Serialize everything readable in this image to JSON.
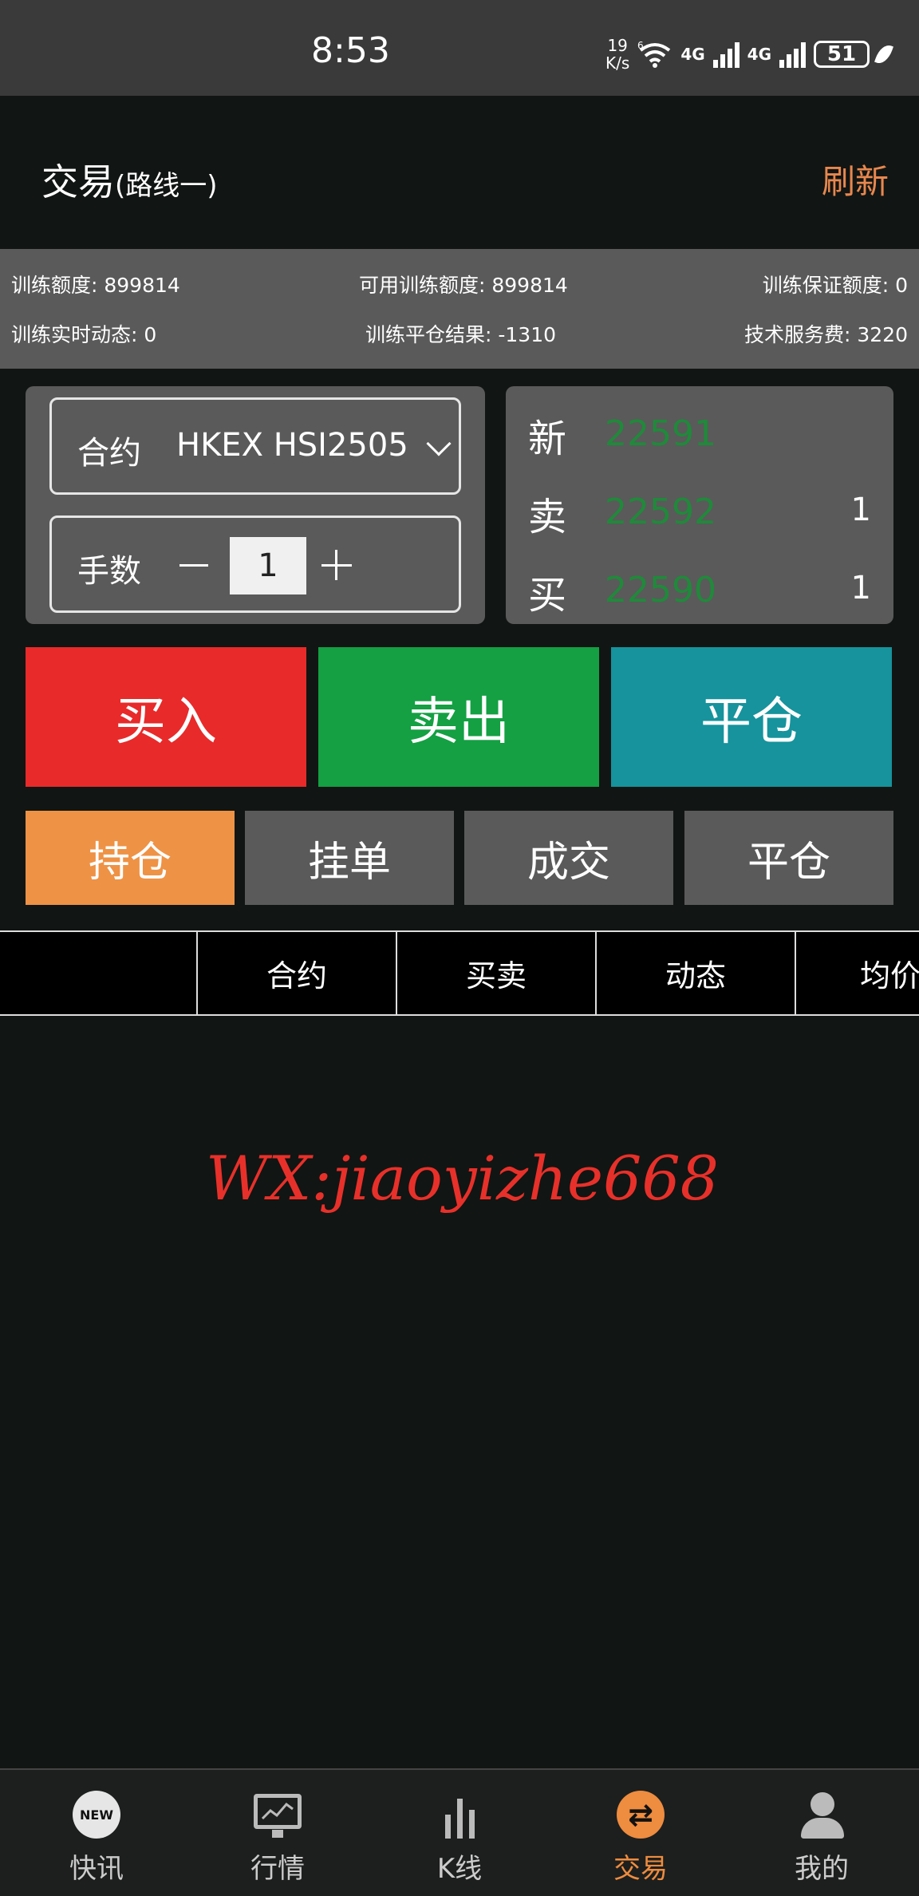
{
  "status_bar": {
    "time": "8:53",
    "net_speed_value": "19",
    "net_speed_unit": "K/s",
    "sig1_label": "4G",
    "sig2_label": "4G",
    "wifi_badge": "6",
    "battery": "51",
    "icons": [
      "wifi-icon",
      "signal-icon",
      "signal-icon",
      "battery-icon",
      "leaf-icon"
    ]
  },
  "header": {
    "title": "交易",
    "subtitle": "(路线一)",
    "refresh": "刷新",
    "accent": "#e8874e"
  },
  "info": {
    "quota": "训练额度: 899814",
    "available": "可用训练额度: 899814",
    "margin": "训练保证额度: 0",
    "realtime": "训练实时动态: 0",
    "close_result": "训练平仓结果: -1310",
    "service_fee": "技术服务费: 3220"
  },
  "contract": {
    "label": "合约",
    "value": "HKEX HSI2505",
    "lots_label": "手数",
    "lots_value": "1"
  },
  "quote": {
    "latest_label": "新",
    "latest": "22591",
    "ask_label": "卖",
    "ask": "22592",
    "ask_qty": "1",
    "bid_label": "买",
    "bid": "22590",
    "bid_qty": "1",
    "price_color": "#1f8a3a"
  },
  "actions": {
    "buy": "买入",
    "sell": "卖出",
    "close": "平仓",
    "colors": {
      "buy": "#e82a2a",
      "sell": "#14a043",
      "close": "#16939c"
    }
  },
  "tabs": [
    {
      "label": "持仓",
      "active": true
    },
    {
      "label": "挂单",
      "active": false
    },
    {
      "label": "成交",
      "active": false
    },
    {
      "label": "平仓",
      "active": false
    }
  ],
  "table": {
    "columns": [
      "",
      "合约",
      "买卖",
      "动态",
      "均价"
    ]
  },
  "watermark": "WX:jiaoyizhe668",
  "nav": [
    {
      "label": "快讯",
      "icon": "new-icon",
      "active": false,
      "badge": "NEW"
    },
    {
      "label": "行情",
      "icon": "monitor-chart-icon",
      "active": false
    },
    {
      "label": "K线",
      "icon": "bar-chart-icon",
      "active": false
    },
    {
      "label": "交易",
      "icon": "trade-swap-icon",
      "active": true
    },
    {
      "label": "我的",
      "icon": "user-icon",
      "active": false
    }
  ]
}
